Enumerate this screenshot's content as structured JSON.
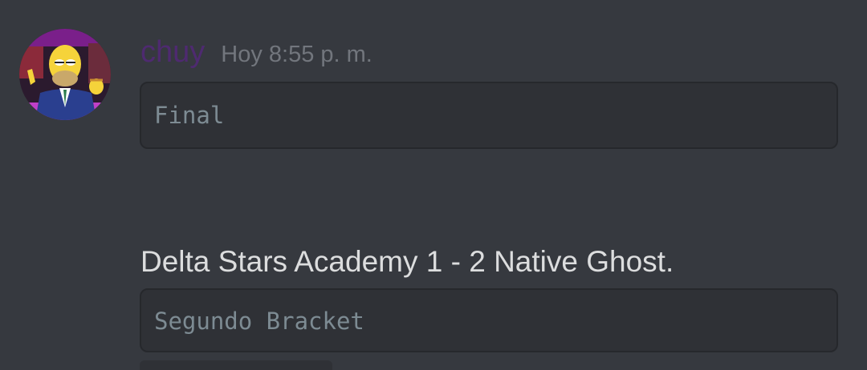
{
  "message": {
    "author": "chuy",
    "timestamp": "Hoy 8:55 p. m.",
    "avatar_icon": "homer-simpson-avatar-icon",
    "code_block_1": "Final",
    "text": "Delta Stars Academy 1 - 2 Native Ghost.",
    "code_block_2": "Segundo Bracket"
  },
  "colors": {
    "background": "#36393f",
    "code_background": "#2f3136",
    "username": "#4e2a70",
    "timestamp": "#72767d",
    "text": "#dcddde",
    "code_text": "#7d8b93"
  }
}
